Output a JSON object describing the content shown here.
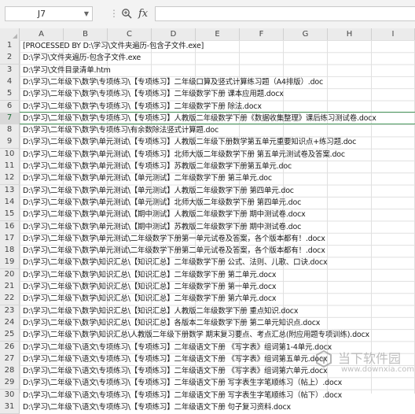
{
  "formula_bar": {
    "cell_reference": "J7",
    "separator": "⋮",
    "fx_label": "fx",
    "formula_value": ""
  },
  "columns": [
    "A",
    "B",
    "C",
    "D",
    "E",
    "F",
    "G",
    "H",
    "I"
  ],
  "rows": [
    {
      "n": "1",
      "text": "[PROCESSED BY D:\\学习\\文件夹遍历-包含子文件.exe]"
    },
    {
      "n": "2",
      "text": "D:\\学习\\文件夹遍历-包含子文件.exe"
    },
    {
      "n": "3",
      "text": "D:\\学习\\文件目录清单.htm"
    },
    {
      "n": "4",
      "text": "D:\\学习\\二年级下\\数学\\专项练习\\【专项练习】二年级口算及竖式计算练习题（A4排版）.doc"
    },
    {
      "n": "5",
      "text": "D:\\学习\\二年级下\\数学\\专项练习\\【专项练习】二年级数学下册 课本应用题.docx"
    },
    {
      "n": "6",
      "text": "D:\\学习\\二年级下\\数学\\专项练习\\【专项练习】二年级数学下册 除法.docx"
    },
    {
      "n": "7",
      "text": "D:\\学习\\二年级下\\数学\\专项练习\\【专项练习】人教版二年级数学下册《数据收集整理》课后练习测试卷.docx"
    },
    {
      "n": "8",
      "text": "D:\\学习\\二年级下\\数学\\专项练习\\有余数除法竖式计算题.doc"
    },
    {
      "n": "9",
      "text": "D:\\学习\\二年级下\\数学\\单元测试\\【专项练习】人教版二年级下册数学第五单元重要知识点+练习题.doc"
    },
    {
      "n": "10",
      "text": "D:\\学习\\二年级下\\数学\\单元测试\\【专项练习】北师大版二年级数学下册 第五单元测试卷及答案.doc"
    },
    {
      "n": "11",
      "text": "D:\\学习\\二年级下\\数学\\单元测试\\【专项练习】苏教版二年级数学下册第五单元.doc"
    },
    {
      "n": "12",
      "text": "D:\\学习\\二年级下\\数学\\单元测试\\【单元测试】二年级数学下册 第三单元.doc"
    },
    {
      "n": "13",
      "text": "D:\\学习\\二年级下\\数学\\单元测试\\【单元测试】人教版二年级数学下册 第四单元.doc"
    },
    {
      "n": "14",
      "text": "D:\\学习\\二年级下\\数学\\单元测试\\【单元测试】北师大版二年级数学下册 第四单元.doc"
    },
    {
      "n": "15",
      "text": "D:\\学习\\二年级下\\数学\\单元测试\\【期中测试】人教版二年级数学下册 期中测试卷.docx"
    },
    {
      "n": "16",
      "text": "D:\\学习\\二年级下\\数学\\单元测试\\【期中测试】苏教版二年级数学下册 期中测试卷.doc"
    },
    {
      "n": "17",
      "text": "D:\\学习\\二年级下\\数学\\单元测试\\二年级数学下册第一单元试卷及答案，各个版本都有！.docx"
    },
    {
      "n": "18",
      "text": "D:\\学习\\二年级下\\数学\\单元测试\\二年级数学下册第二单元试卷及答案，各个版本都有！.docx"
    },
    {
      "n": "19",
      "text": "D:\\学习\\二年级下\\数学\\知识汇总\\【知识汇总】二年级数学下册 公式、法则、儿歌、口诀.docx"
    },
    {
      "n": "20",
      "text": "D:\\学习\\二年级下\\数学\\知识汇总\\【知识汇总】二年级数学下册 第二单元.docx"
    },
    {
      "n": "21",
      "text": "D:\\学习\\二年级下\\数学\\知识汇总\\【知识汇总】二年级数学下册 第一单元.docx"
    },
    {
      "n": "22",
      "text": "D:\\学习\\二年级下\\数学\\知识汇总\\【知识汇总】二年级数学下册 第六单元.docx"
    },
    {
      "n": "23",
      "text": "D:\\学习\\二年级下\\数学\\知识汇总\\【知识汇总】人教版二年级数学下册 重点知识.docx"
    },
    {
      "n": "24",
      "text": "D:\\学习\\二年级下\\数学\\知识汇总\\【知识汇总】各版本二年级数学下册 第二单元知识点.docx"
    },
    {
      "n": "25",
      "text": "D:\\学习\\二年级下\\数学\\知识汇总\\人教版二年级下册数学 期末复习要点、考点汇总(附应用题专项训练).docx"
    },
    {
      "n": "26",
      "text": "D:\\学习\\二年级下\\语文\\专项练习\\【专项练习】二年级语文下册 《写字表》组词第1-4单元.docx"
    },
    {
      "n": "27",
      "text": "D:\\学习\\二年级下\\语文\\专项练习\\【专项练习】二年级语文下册 《写字表》组词第五单元.docx"
    },
    {
      "n": "28",
      "text": "D:\\学习\\二年级下\\语文\\专项练习\\【专项练习】二年级语文下册 《写字表》组词第六单元.docx"
    },
    {
      "n": "29",
      "text": "D:\\学习\\二年级下\\语文\\专项练习\\【专项练习】二年级语文下册 写字表生字笔顺练习（帖上）.docx"
    },
    {
      "n": "30",
      "text": "D:\\学习\\二年级下\\语文\\专项练习\\【专项练习】二年级语文下册 写字表生字笔顺练习（帖下）.docx"
    },
    {
      "n": "31",
      "text": "D:\\学习\\二年级下\\语文\\专项练习\\【专项练习】二年级语文下册 句子复习资料.docx"
    }
  ],
  "watermark": {
    "title": "当下软件园",
    "url": "www.downxia.com"
  },
  "colors": {
    "selection": "#4a9b5e",
    "header_bg": "#ebebeb",
    "grid_line": "#e0e0e0"
  }
}
